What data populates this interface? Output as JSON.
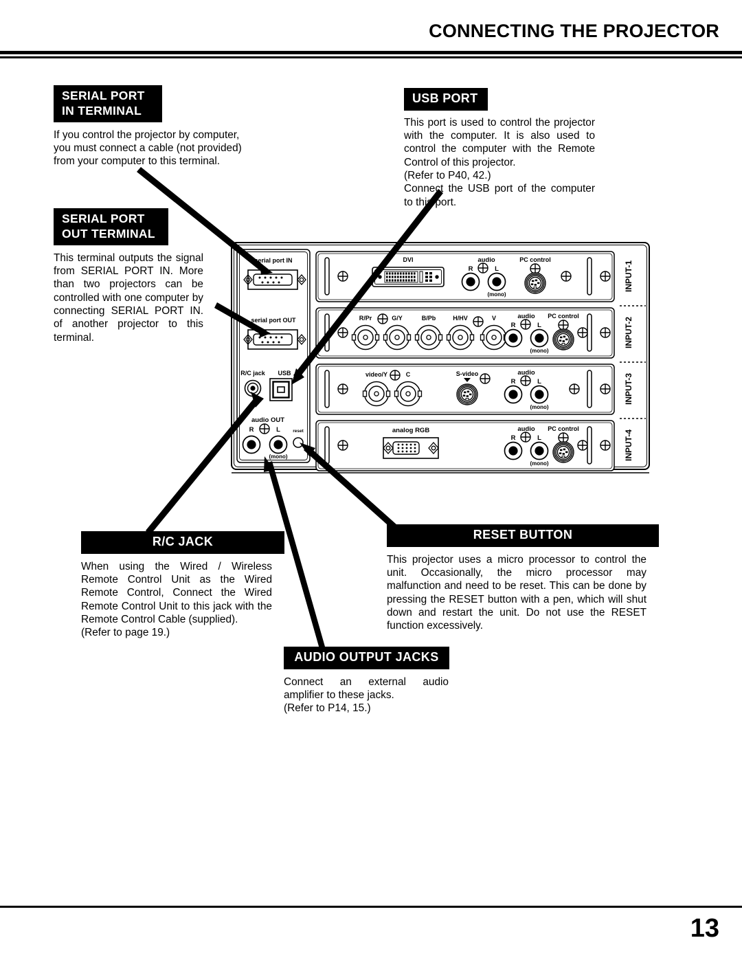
{
  "page": {
    "title": "CONNECTING THE PROJECTOR",
    "number": "13"
  },
  "callouts": {
    "serial_port_in": {
      "heading_line1": "SERIAL  PORT",
      "heading_line2": "IN TERMINAL",
      "body": "If you control the projector by computer, you must connect a cable (not provided) from your computer to this terminal."
    },
    "serial_port_out": {
      "heading_line1": "SERIAL  PORT",
      "heading_line2": "OUT TERMINAL",
      "body": "This terminal outputs the signal from SERIAL PORT IN. More than two projectors can be controlled with one computer by connecting SERIAL PORT IN. of another projector to this terminal."
    },
    "usb_port": {
      "heading": "USB PORT",
      "body_part1": "This port is used to control the projector with the computer. It is also used to control the computer with the Remote Control of this projector.",
      "body_part2": "(Refer to P40, 42.)",
      "body_part3": "Connect the USB port of the computer to this port."
    },
    "rc_jack": {
      "heading": "R/C JACK",
      "body_part1": "When using the Wired / Wireless Remote Control Unit as the Wired Remote Control, Connect the Wired Remote Control Unit to this jack with the Remote Control Cable (supplied).",
      "body_part2": "(Refer to page 19.)"
    },
    "reset_button": {
      "heading": "RESET BUTTON",
      "body": "This projector uses a micro processor to control the unit.  Occasionally, the micro processor may malfunction and need to be reset.  This can be done by pressing the RESET button with a pen, which will shut down and restart the unit.  Do not use the RESET function excessively."
    },
    "audio_output_jacks": {
      "heading": "AUDIO OUTPUT JACKS",
      "body_part1": "Connect an external audio amplifier to these jacks.",
      "body_part2": "(Refer to P14, 15.)"
    }
  },
  "panel": {
    "left_column": {
      "serial_in_label": "serial port IN",
      "serial_out_label": "serial port OUT",
      "rc_jack_label": "R/C jack",
      "usb_label": "USB",
      "audio_out_label": "audio OUT",
      "audio_out_r": "R",
      "audio_out_l": "L",
      "audio_out_mono": "(mono)",
      "reset_label": "reset"
    },
    "rows": [
      {
        "name": "INPUT-1",
        "connectors": [
          "DVI"
        ],
        "audio_label": "audio",
        "audio_r": "R",
        "audio_l": "L",
        "audio_mono": "(mono)",
        "pc_control_label": "PC control"
      },
      {
        "name": "INPUT-2",
        "connectors": [
          "R/Pr",
          "G/Y",
          "B/Pb",
          "H/HV",
          "V"
        ],
        "audio_label": "audio",
        "audio_r": "R",
        "audio_l": "L",
        "audio_mono": "(mono)",
        "pc_control_label": "PC control"
      },
      {
        "name": "INPUT-3",
        "connectors": [
          "video/Y",
          "C",
          "S-video"
        ],
        "audio_label": "audio",
        "audio_r": "R",
        "audio_l": "L",
        "audio_mono": "(mono)",
        "pc_control_label": ""
      },
      {
        "name": "INPUT-4",
        "connectors": [
          "analog RGB"
        ],
        "audio_label": "audio",
        "audio_r": "R",
        "audio_l": "L",
        "audio_mono": "(mono)",
        "pc_control_label": "PC control"
      }
    ]
  },
  "colors": {
    "ink": "#000000",
    "paper": "#ffffff"
  }
}
